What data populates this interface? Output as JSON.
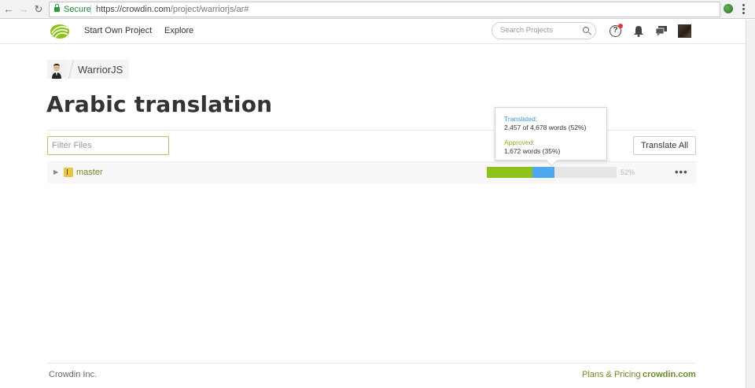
{
  "browser": {
    "secure_label": "Secure",
    "url_scheme": "https://",
    "url_host": "crowdin.com",
    "url_path": "/project/warriorjs/ar#"
  },
  "header": {
    "nav_own_project": "Start Own Project",
    "nav_explore": "Explore",
    "search_placeholder": "Search Projects"
  },
  "breadcrumb": {
    "project_name": "WarriorJS"
  },
  "page": {
    "title": "Arabic translation",
    "filter_placeholder": "Filter Files",
    "translate_all_label": "Translate All"
  },
  "files": [
    {
      "name": "master",
      "percent_label": "52%",
      "approved_fraction": 0.35,
      "translated_fraction": 0.52
    }
  ],
  "tooltip": {
    "translated_label": "Translated:",
    "translated_value": "2,457 of 4,678 words (52%)",
    "approved_label": "Approved:",
    "approved_value": "1,672 words (35%)"
  },
  "footer": {
    "company": "Crowdin Inc.",
    "plans_link": "Plans & Pricing",
    "site_link": "crowdin.com"
  },
  "colors": {
    "brand_green": "#6d8c2a",
    "approved_bar": "#8cc21a",
    "translated_bar": "#4ea8f0"
  }
}
